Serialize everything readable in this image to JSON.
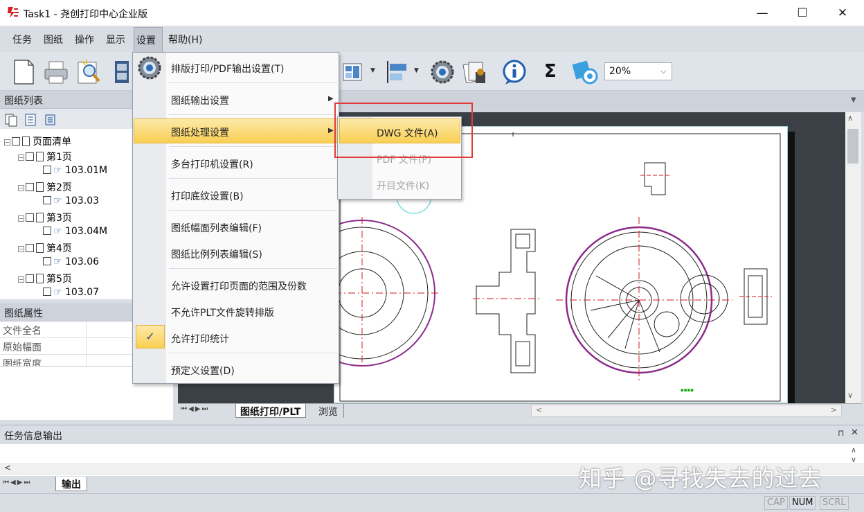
{
  "window": {
    "title": "Task1 - 尧创打印中心企业版",
    "minimize": "—",
    "maximize": "☐",
    "close": "✕"
  },
  "menubar": [
    "任务",
    "图纸",
    "操作",
    "显示",
    "设置",
    "帮助(H)"
  ],
  "toolbar": {
    "zoom_value": "20%",
    "sigma": "Σ"
  },
  "left_panel": {
    "list_title": "图纸列表",
    "tree": {
      "root": "页面清单",
      "pages": [
        {
          "label": "第1页",
          "file": "103.01M"
        },
        {
          "label": "第2页",
          "file": "103.03"
        },
        {
          "label": "第3页",
          "file": "103.04M"
        },
        {
          "label": "第4页",
          "file": "103.06"
        },
        {
          "label": "第5页",
          "file": "103.07"
        }
      ]
    },
    "props_title": "图纸属性",
    "props": [
      "文件全名",
      "原始幅面",
      "图纸宽度"
    ]
  },
  "view_tabs": [
    "图纸打印/PLT",
    "浏览"
  ],
  "output": {
    "title": "任务信息输出",
    "tab": "输出"
  },
  "status": [
    "CAP",
    "NUM",
    "SCRL"
  ],
  "settings_menu": {
    "items": [
      {
        "label": "排版打印/PDF输出设置(T)"
      },
      {
        "label": "图纸输出设置",
        "submenu": true
      },
      {
        "label": "图纸处理设置",
        "submenu": true,
        "highlighted": true
      },
      {
        "label": "多台打印机设置(R)"
      },
      {
        "label": "打印底纹设置(B)"
      },
      {
        "label": "图纸幅面列表编辑(F)"
      },
      {
        "label": "图纸比例列表编辑(S)"
      },
      {
        "label": "允许设置打印页面的范围及份数"
      },
      {
        "label": "不允许PLT文件旋转排版"
      },
      {
        "label": "允许打印统计",
        "checked": true
      },
      {
        "label": "预定义设置(D)"
      }
    ],
    "check_mark": "✓"
  },
  "submenu": {
    "items": [
      {
        "label": "DWG 文件(A)",
        "highlighted": true
      },
      {
        "label": "PDF 文件(P)",
        "disabled": true
      },
      {
        "label": "开目文件(K)",
        "disabled": true
      }
    ]
  },
  "watermark": "知乎 @寻找失去的过去",
  "colors": {
    "highlight": "#f9cf52",
    "annotation_box": "#e23b3b",
    "drawing_red": "#d4141c",
    "drawing_purple": "#8a2a8a"
  }
}
